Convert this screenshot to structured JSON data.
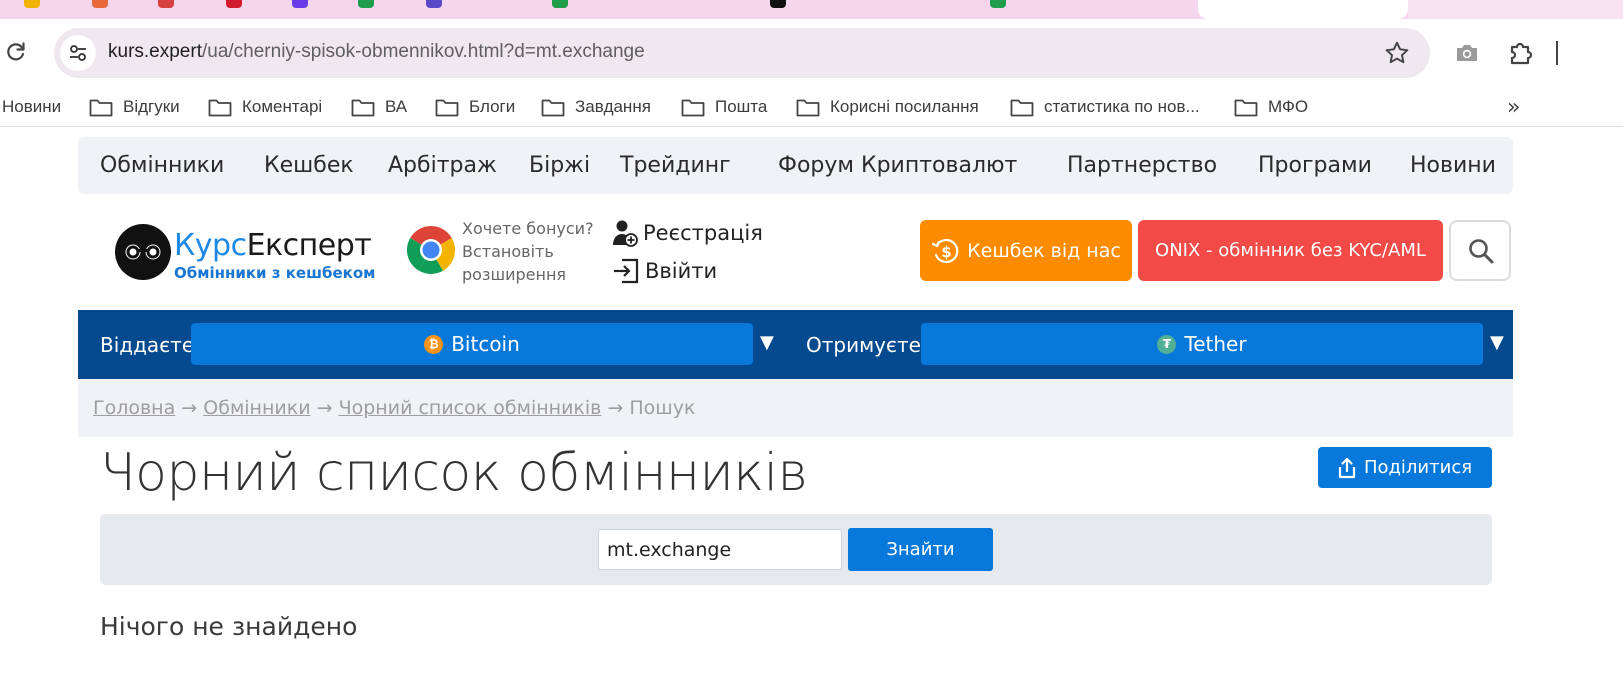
{
  "browser": {
    "url_host": "kurs.expert",
    "url_path": "/ua/cherniy-spisok-obmennikov.html?d=mt.exchange",
    "bookmarks": [
      {
        "label": "Новини",
        "folder": false
      },
      {
        "label": "Відгуки",
        "folder": true
      },
      {
        "label": "Коментарі",
        "folder": true
      },
      {
        "label": "ВА",
        "folder": true
      },
      {
        "label": "Блоги",
        "folder": true
      },
      {
        "label": "Завдання",
        "folder": true
      },
      {
        "label": "Пошта",
        "folder": true
      },
      {
        "label": "Корисні посилання",
        "folder": true
      },
      {
        "label": "статистика по нов...",
        "folder": true
      },
      {
        "label": "МФО",
        "folder": true
      }
    ],
    "bookmarks_overflow": "»"
  },
  "nav": {
    "items": [
      "Обмінники",
      "Кешбек",
      "Арбітраж",
      "Біржі",
      "Трейдинг",
      "Форум Криптовалют",
      "Партнерство",
      "Програми",
      "Новини"
    ]
  },
  "header": {
    "logo_part1": "Курс",
    "logo_part2": "Експерт",
    "logo_sub": "Обмінники з кешбеком",
    "promo_line1": "Хочете бонуси?",
    "promo_line2": "Встановіть",
    "promo_line3": "розширення",
    "register_label": "Реєстрація",
    "login_label": "Ввійти",
    "cashback_label": "Кешбек від нас",
    "onix_label": "ONIX - обмінник без KYC/AML"
  },
  "exchange": {
    "give_label": "Віддаєте",
    "give_currency": "Bitcoin",
    "get_label": "Отримуєте",
    "get_currency": "Tether",
    "arrow": "▼"
  },
  "breadcrumb": {
    "home": "Головна",
    "exchangers": "Обмінники",
    "blacklist": "Чорний список обмінників",
    "current": "Пошук",
    "sep": "→"
  },
  "main": {
    "title": "Чорний список обмінників",
    "share_label": "Поділитися",
    "search_value": "mt.exchange",
    "find_label": "Знайти",
    "no_results": "Нічого не знайдено"
  }
}
